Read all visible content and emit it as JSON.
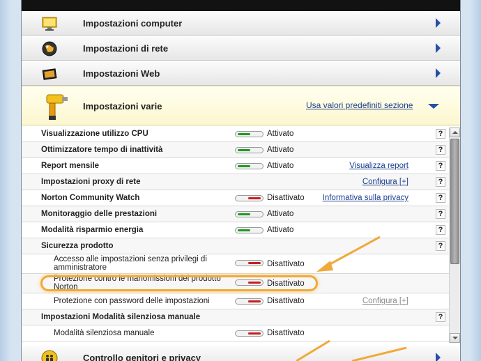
{
  "sections": [
    {
      "label": "Impostazioni computer",
      "icon": "monitor-icon"
    },
    {
      "label": "Impostazioni di rete",
      "icon": "globe-icon"
    },
    {
      "label": "Impostazioni Web",
      "icon": "web-icon"
    }
  ],
  "expanded": {
    "label": "Impostazioni varie",
    "icon": "drill-icon",
    "reset_link": "Usa valori predefiniti sezione"
  },
  "rows": [
    {
      "name": "Visualizzazione utilizzo CPU",
      "state": "Attivato"
    },
    {
      "name": "Ottimizzatore tempo di inattività",
      "state": "Attivato"
    },
    {
      "name": "Report mensile",
      "state": "Attivato",
      "link": "Visualizza report"
    },
    {
      "name": "Impostazioni proxy di rete",
      "link": "Configura [+]"
    },
    {
      "name": "Norton Community Watch",
      "state": "Disattivato",
      "link": "Informativa sulla privacy"
    },
    {
      "name": "Monitoraggio delle prestazioni",
      "state": "Attivato"
    },
    {
      "name": "Modalità risparmio energia",
      "state": "Attivato"
    },
    {
      "name": "Sicurezza prodotto"
    },
    {
      "name": "Accesso alle impostazioni senza privilegi di amministratore",
      "state": "Disattivato"
    },
    {
      "name": "Protezione contro le manomissioni del prodotto Norton",
      "state": "Disattivato"
    },
    {
      "name": "Protezione con password delle impostazioni",
      "state": "Disattivato",
      "link": "Configura [+]"
    },
    {
      "name": "Impostazioni Modalità silenziosa manuale"
    },
    {
      "name": "Modalità silenziosa manuale",
      "state": "Disattivato"
    }
  ],
  "help_label": "?",
  "bottom_section": {
    "label": "Controllo genitori e privacy",
    "icon": "family-icon"
  },
  "colors": {
    "on": "#1e9a22",
    "off": "#c4201f",
    "accent": "#2450a8",
    "callout": "#f0a93a"
  }
}
